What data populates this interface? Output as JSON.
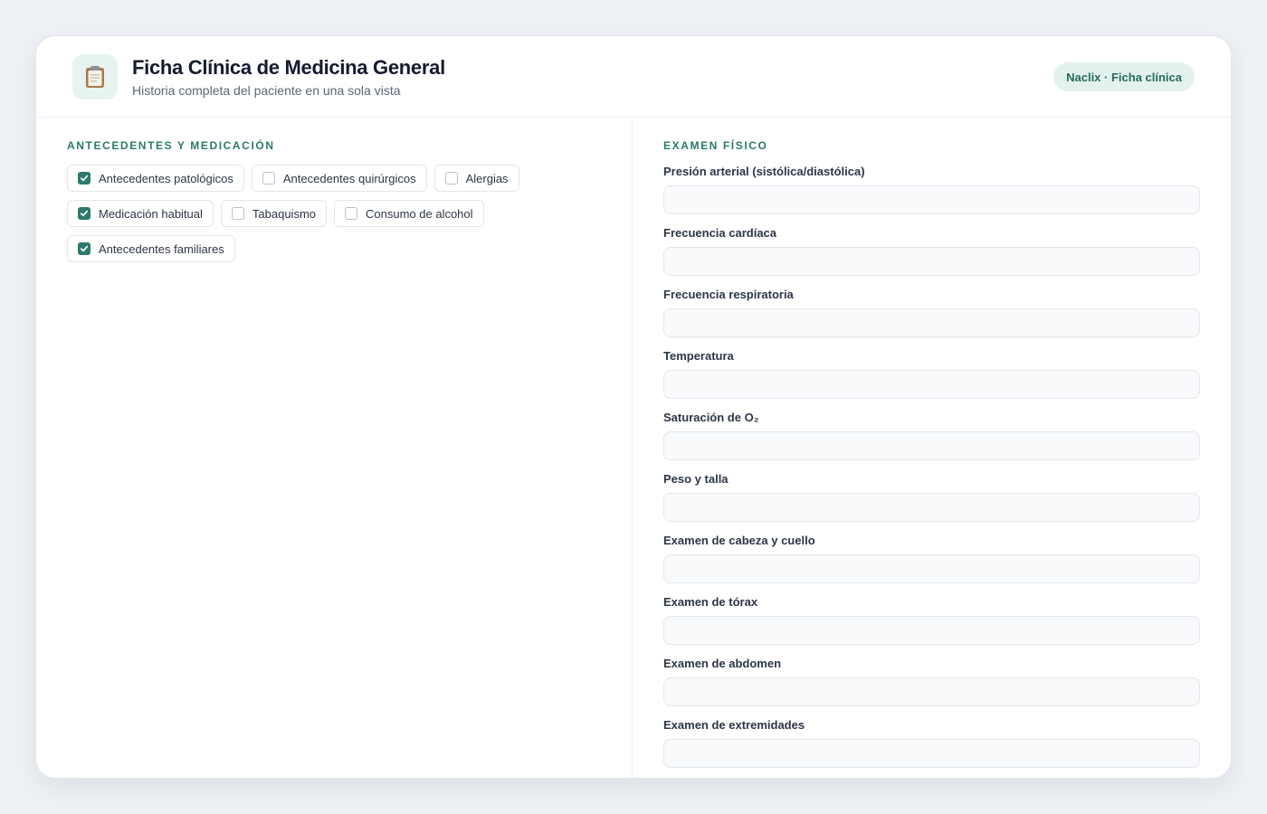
{
  "header": {
    "title": "Ficha Clínica de Medicina General",
    "subtitle": "Historia completa del paciente en una sola vista",
    "badge": "Naclix · Ficha clínica",
    "icon": "clipboard-icon"
  },
  "left": {
    "section_title": "ANTECEDENTES Y MEDICACIÓN",
    "checkboxes": [
      {
        "label": "Antecedentes patológicos",
        "checked": true
      },
      {
        "label": "Antecedentes quirúrgicos",
        "checked": false
      },
      {
        "label": "Alergias",
        "checked": false
      },
      {
        "label": "Medicación habitual",
        "checked": true
      },
      {
        "label": "Tabaquismo",
        "checked": false
      },
      {
        "label": "Consumo de alcohol",
        "checked": false
      },
      {
        "label": "Antecedentes familiares",
        "checked": true
      }
    ]
  },
  "right": {
    "section_title": "EXAMEN FÍSICO",
    "fields": [
      {
        "label": "Presión arterial (sistólica/diastólica)",
        "value": "",
        "placeholder": ""
      },
      {
        "label": "Frecuencia cardíaca",
        "value": "",
        "placeholder": ""
      },
      {
        "label": "Frecuencia respiratoria",
        "value": "",
        "placeholder": ""
      },
      {
        "label": "Temperatura",
        "value": "",
        "placeholder": ""
      },
      {
        "label": "Saturación de O₂",
        "value": "",
        "placeholder": ""
      },
      {
        "label": "Peso y talla",
        "value": "",
        "placeholder": ""
      },
      {
        "label": "Examen de cabeza y cuello",
        "value": "",
        "placeholder": ""
      },
      {
        "label": "Examen de tórax",
        "value": "",
        "placeholder": ""
      },
      {
        "label": "Examen de abdomen",
        "value": "",
        "placeholder": ""
      },
      {
        "label": "Examen de extremidades",
        "value": "",
        "placeholder": ""
      }
    ]
  },
  "colors": {
    "accent": "#2b7a6c",
    "badge_bg": "#e4f2ee",
    "icon_bg": "#e6f3ef",
    "page_bg": "#eef1f5"
  }
}
